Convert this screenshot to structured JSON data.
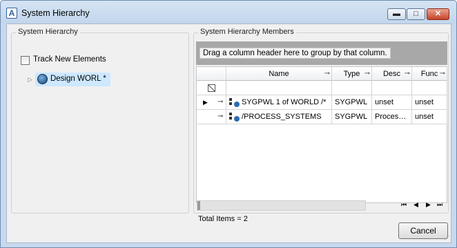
{
  "window": {
    "title": "System Hierarchy",
    "minimize_icon": "minimize-icon",
    "maximize_icon": "maximize-icon",
    "close_icon": "close-icon"
  },
  "left_panel": {
    "title": "System Hierarchy",
    "track_new_elements": {
      "label": "Track New Elements",
      "checked": false
    },
    "tree": {
      "node_label": "Design WORL *",
      "expanded": false,
      "selected": true
    }
  },
  "right_panel": {
    "title": "System Hierarchy Members",
    "group_hint": "Drag a column header here to group by that column.",
    "columns": [
      "Name",
      "Type",
      "Desc",
      "Func"
    ],
    "rows": [
      {
        "name": "SYGPWL 1 of WORLD /*",
        "type": "SYGPWL",
        "desc": "unset",
        "func": "unset",
        "current": true
      },
      {
        "name": "/PROCESS_SYSTEMS",
        "type": "SYGPWL",
        "desc": "Proces…",
        "func": "unset",
        "current": false
      }
    ],
    "total_items": "Total Items = 2"
  },
  "footer": {
    "cancel_label": "Cancel"
  },
  "colors": {
    "title_bg": "#c7d9ee",
    "selection": "#cde8ff",
    "close_red": "#c7432a"
  }
}
